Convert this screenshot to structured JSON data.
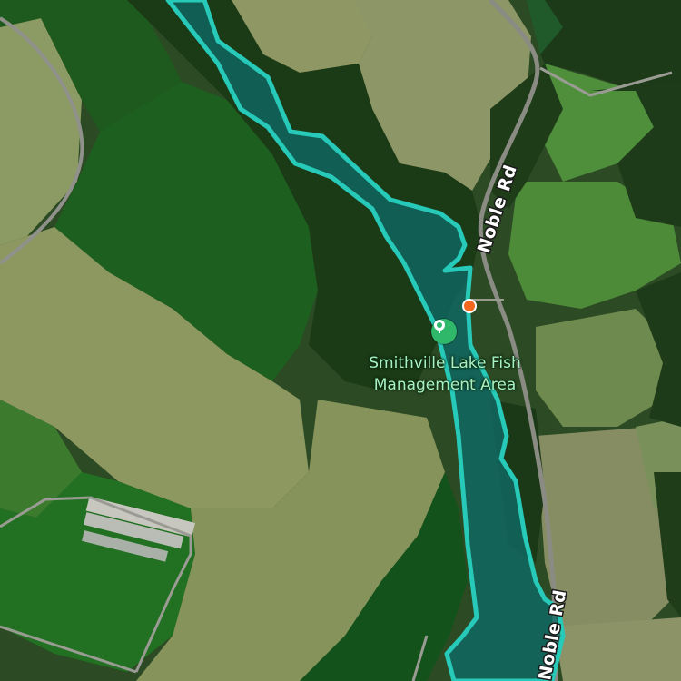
{
  "map": {
    "type": "satellite",
    "colors": {
      "area_outline": "#27c9b8",
      "area_fill": "#0e6a66",
      "poi_pin": "#2fb86a",
      "poi_label": "#a8f2c2",
      "route_marker": "#f2661e"
    }
  },
  "roads": [
    {
      "id": "noble-rd-north",
      "label": "Noble Rd"
    },
    {
      "id": "noble-rd-south",
      "label": "Noble Rd"
    }
  ],
  "poi": {
    "icon": "tree-icon",
    "name_line1": "Smithville Lake Fish",
    "name_line2": "Management Area"
  },
  "marker": {
    "icon": "location-dot"
  }
}
